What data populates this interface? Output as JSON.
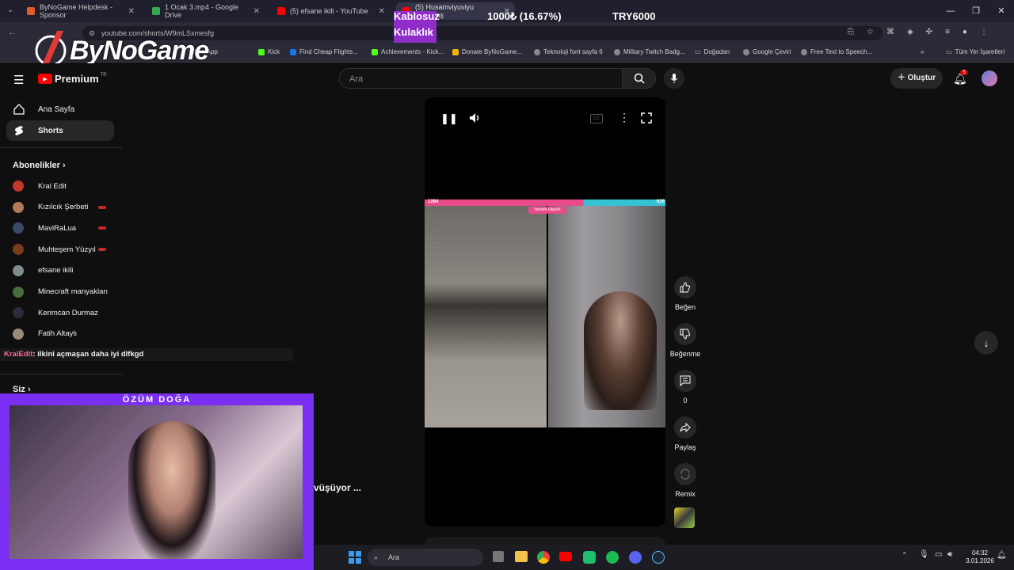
{
  "browser": {
    "tabs": [
      {
        "title": "ByNoGame Helpdesk - Sponsor",
        "color": "#e05c2b"
      },
      {
        "title": "1 Ocak 3.mp4 - Google Drive",
        "color": "#34a853"
      },
      {
        "title": "(5) efsane ikili - YouTube",
        "color": "#ff0000"
      },
      {
        "title": "(5) Husamviyuviyu sanaldaş",
        "color": "#ff0000"
      }
    ],
    "url": "youtube.com/shorts/W9mLSxmesfg",
    "bookmarks": [
      "WhatsApp",
      "Kick",
      "Find Cheap Flights...",
      "Achievements - Kick...",
      "Donate ByNoGame...",
      "Teknoloji font sayfa 6",
      "Military Twitch Badg...",
      "Doğadan",
      "Google Çeviri",
      "Free Text to Speech..."
    ],
    "bookmarks_all": "Tüm Yer İşaretleri"
  },
  "brand_overlay": {
    "logo_text": "ByNoGame"
  },
  "donation": {
    "item_line1": "Kablosuz",
    "item_line2": "Kulaklık",
    "progress": "1000₺ (16.67%)",
    "goal": "TRY6000"
  },
  "youtube": {
    "logo": "Premium",
    "logo_region": "TR",
    "search_placeholder": "Ara",
    "create_label": "Oluştur",
    "notif_count": "5",
    "nav": [
      {
        "label": "Ana Sayfa"
      },
      {
        "label": "Shorts"
      }
    ],
    "subs_title": "Abonelikler",
    "subscriptions": [
      {
        "name": "Kral Edit",
        "color": "#c0392b",
        "live": false
      },
      {
        "name": "Kızılcık Şerbeti",
        "color": "#b07a5a",
        "live": true
      },
      {
        "name": "MaviRaLua",
        "color": "#3b4a6b",
        "live": true
      },
      {
        "name": "Muhteşem Yüzyıl",
        "color": "#7a3b1c",
        "live": true
      },
      {
        "name": "efsane ikili",
        "color": "#7f8c8d",
        "live": false
      },
      {
        "name": "Minecraft manyakları",
        "color": "#4a6b3b",
        "live": false
      },
      {
        "name": "Kerimcan Durmaz",
        "color": "#2c2c3c",
        "live": false
      },
      {
        "name": "Fatih Altaylı",
        "color": "#9a8a7a",
        "live": false
      }
    ],
    "you_title": "Siz",
    "shorts_title_fragment": "vüşüyor ...",
    "actions": {
      "like": "Beğen",
      "dislike": "Beğenme",
      "comments": "0",
      "share": "Paylaş",
      "remix": "Remix"
    },
    "pk": {
      "left_score": "1284",
      "right_score": "626",
      "banner": "Hedefe ulaşıldı"
    }
  },
  "stream": {
    "chat_user": "KralEdit",
    "chat_message": ": ilkini açmaşan daha iyi dlfkgd",
    "cam_name": "ÖZÜM DOĞA"
  },
  "taskbar": {
    "search": "Ara",
    "time": "04:32",
    "date": "3.01.2026"
  }
}
